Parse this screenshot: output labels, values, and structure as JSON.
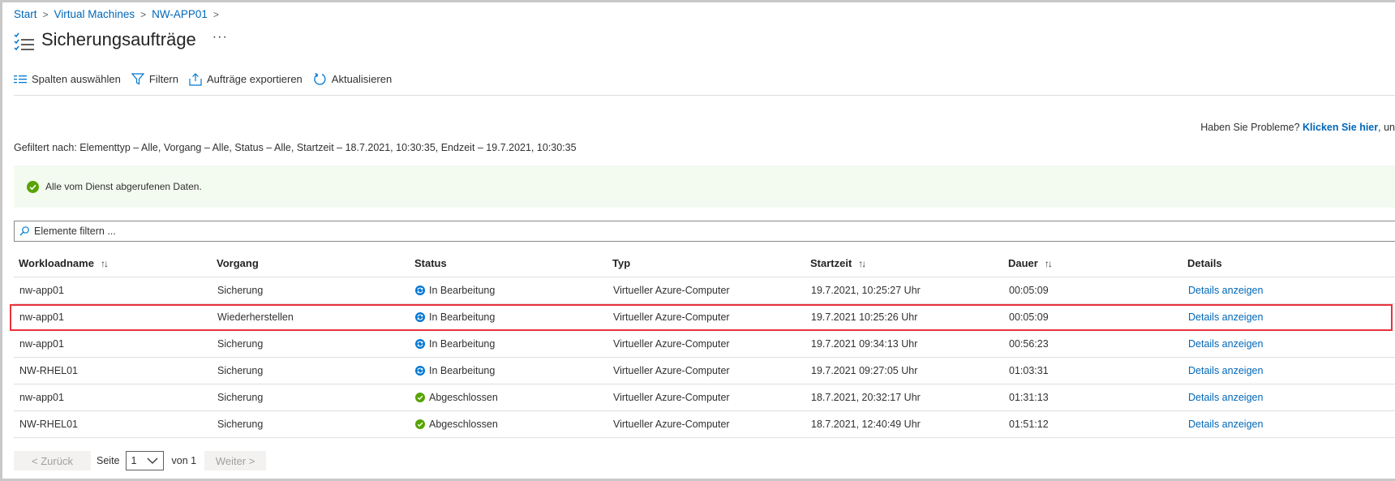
{
  "breadcrumb": [
    "Start",
    "Virtual Machines",
    "NW-APP01"
  ],
  "title": "Sicherungsaufträge",
  "more_label": "···",
  "toolbar": {
    "columns": "Spalten auswählen",
    "filter": "Filtern",
    "export": "Aufträge exportieren",
    "refresh": "Aktualisieren"
  },
  "help": {
    "prefix": "Haben Sie Probleme?",
    "link": "Klicken Sie hier",
    "suffix": ", un"
  },
  "filter_info": "Gefiltert nach: Elementtyp – Alle, Vorgang – Alle, Status – Alle, Startzeit – 18.7.2021, 10:30:35, Endzeit – 19.7.2021, 10:30:35",
  "banner": "Alle vom Dienst abgerufenen Daten.",
  "search": {
    "placeholder": "Elemente filtern ..."
  },
  "table": {
    "sort_icon": "↑↓",
    "columns": [
      "Workloadname",
      "Vorgang",
      "Status",
      "Typ",
      "Startzeit",
      "Dauer",
      "Details"
    ],
    "rows": [
      {
        "name": "nw-app01",
        "op": "Sicherung",
        "status": "In Bearbeitung",
        "status_icon": "sync-icon",
        "type": "Virtueller Azure-Computer",
        "start": "19.7.2021, 10:25:27 Uhr",
        "duration": "00:05:09",
        "details": "Details anzeigen"
      },
      {
        "name": "nw-app01",
        "op": "Wiederherstellen",
        "status": "In Bearbeitung",
        "status_icon": "sync-icon",
        "type": "Virtueller Azure-Computer",
        "start": "19.7.2021 10:25:26 Uhr",
        "duration": "00:05:09",
        "details": "Details anzeigen"
      },
      {
        "name": "nw-app01",
        "op": "Sicherung",
        "status": "In Bearbeitung",
        "status_icon": "sync-icon",
        "type": "Virtueller Azure-Computer",
        "start": "19.7.2021 09:34:13 Uhr",
        "duration": "00:56:23",
        "details": "Details anzeigen"
      },
      {
        "name": "NW-RHEL01",
        "op": "Sicherung",
        "status": "In Bearbeitung",
        "status_icon": "sync-icon",
        "type": "Virtueller Azure-Computer",
        "start": "19.7.2021 09:27:05 Uhr",
        "duration": "01:03:31",
        "details": "Details anzeigen"
      },
      {
        "name": "nw-app01",
        "op": "Sicherung",
        "status": "Abgeschlossen",
        "status_icon": "check-circle-icon",
        "type": "Virtueller Azure-Computer",
        "start": "18.7.2021, 20:32:17 Uhr",
        "duration": "01:31:13",
        "details": "Details anzeigen"
      },
      {
        "name": "NW-RHEL01",
        "op": "Sicherung",
        "status": "Abgeschlossen",
        "status_icon": "check-circle-icon",
        "type": "Virtueller Azure-Computer",
        "start": "18.7.2021, 12:40:49 Uhr",
        "duration": "01:51:12",
        "details": "Details anzeigen"
      }
    ]
  },
  "pager": {
    "prev": "< Zurück",
    "page_label": "Seite",
    "page_value": "1",
    "of_label": "von 1",
    "next": "Weiter >"
  },
  "colors": {
    "link": "#0067b8",
    "success": "#57a300",
    "progress": "#0078d4",
    "highlight": "#e8333b",
    "banner_bg": "#f3faf0"
  }
}
